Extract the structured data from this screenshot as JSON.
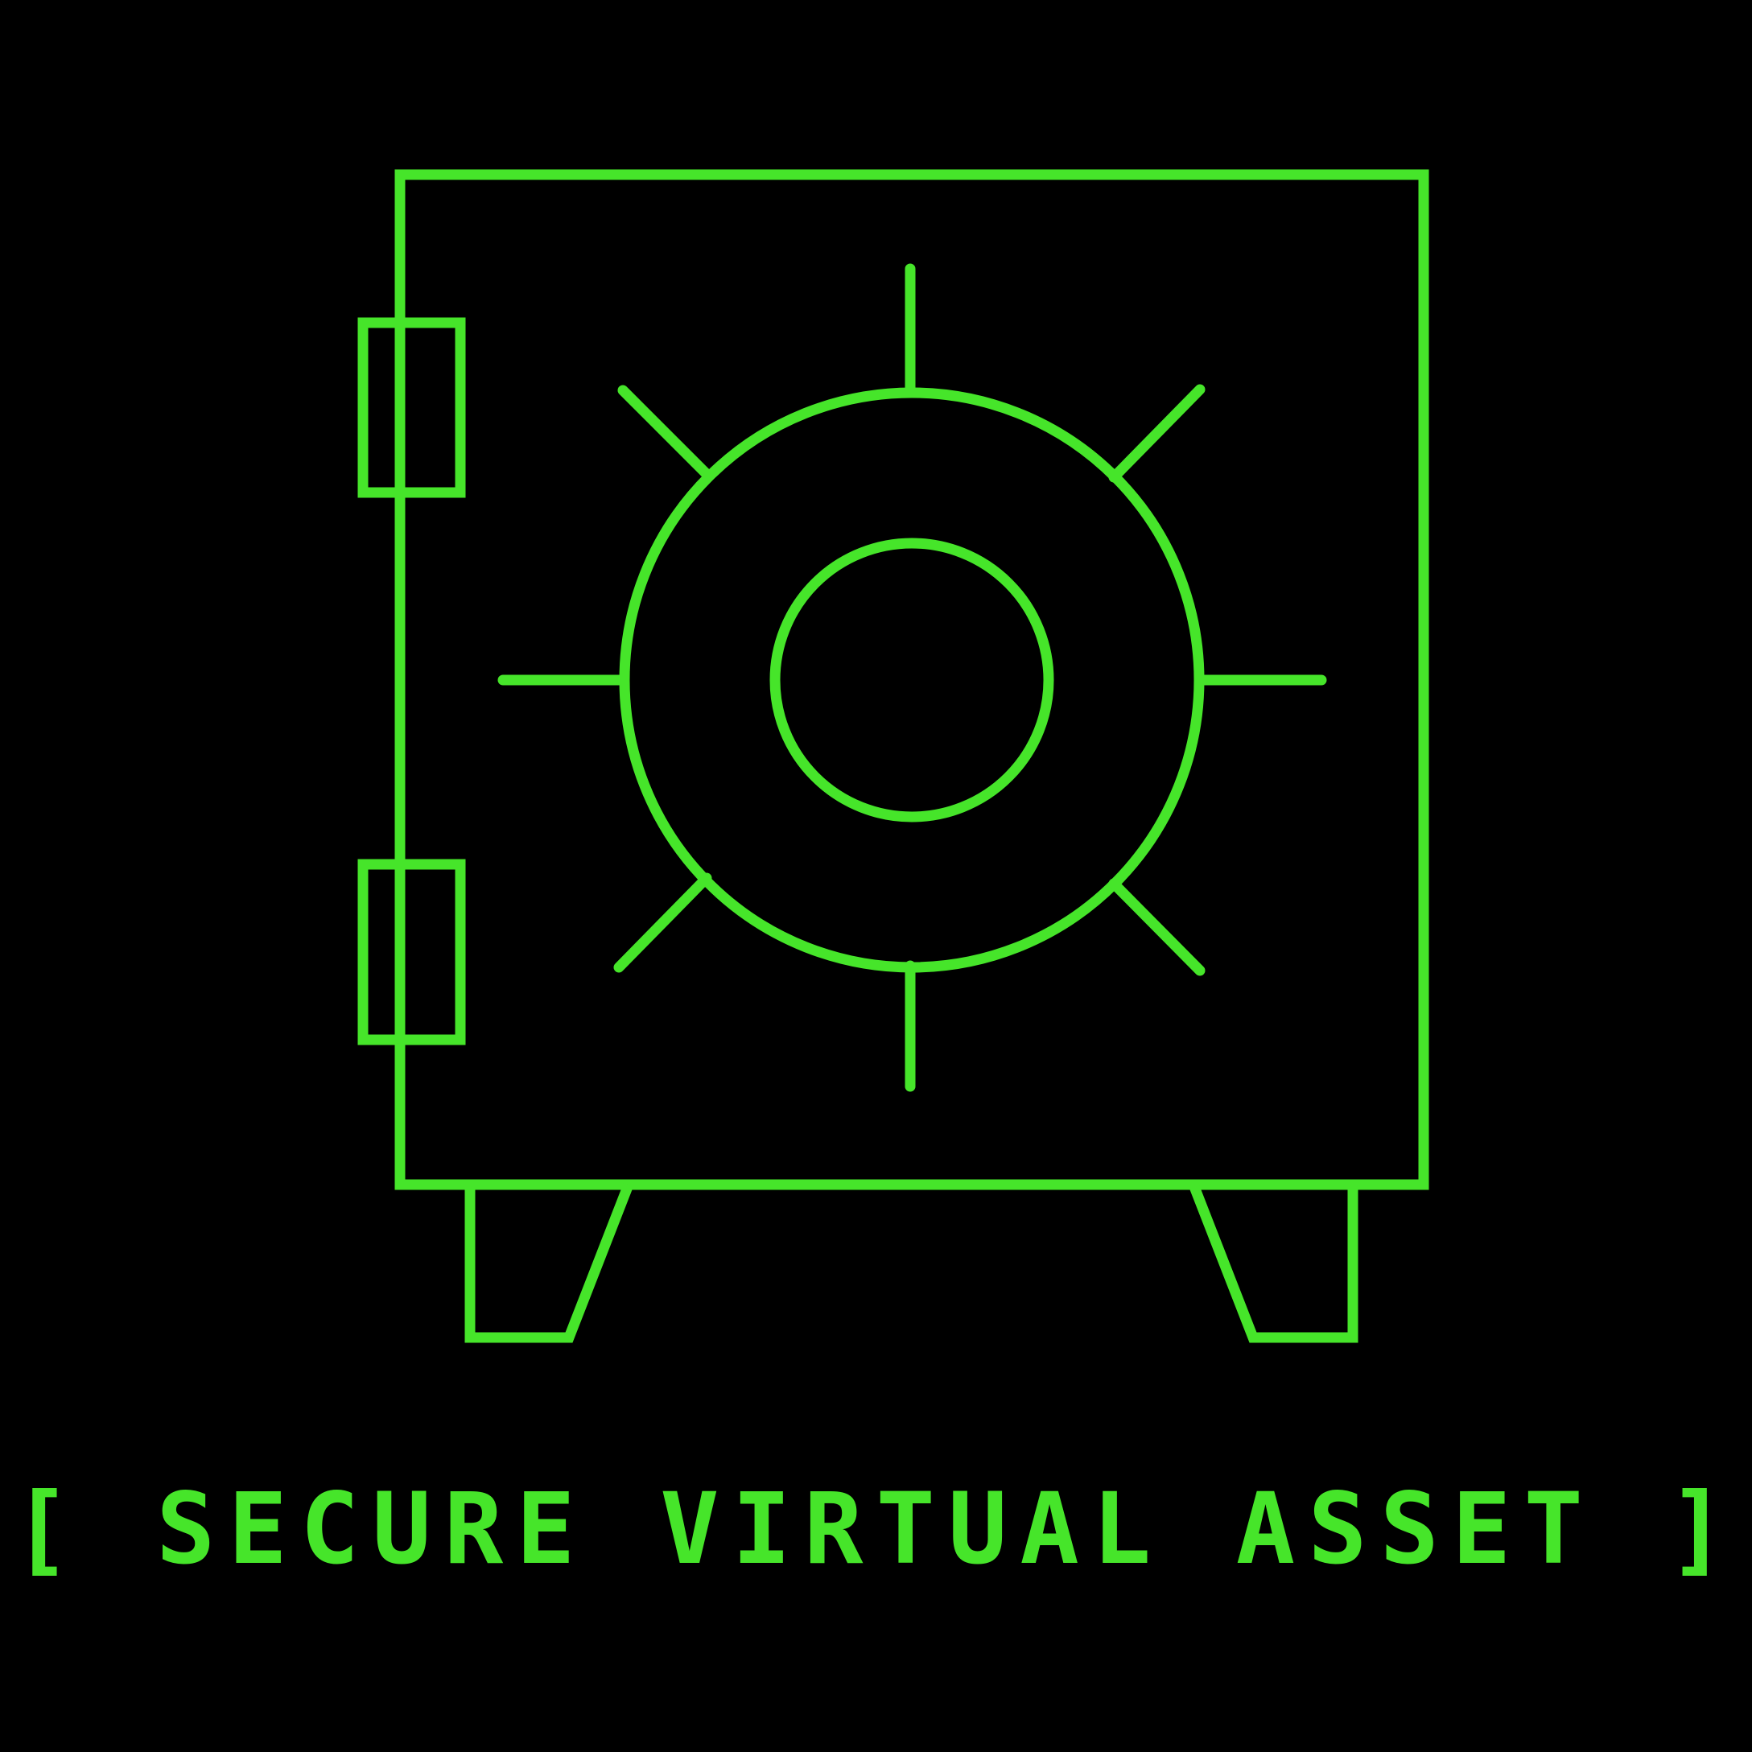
{
  "colors": {
    "background": "#000000",
    "accent": "#46e52a"
  },
  "illustration": {
    "icon": "vault-safe-icon",
    "parts": [
      "safe-body",
      "hinge-top",
      "hinge-bottom",
      "dial-outer",
      "dial-inner",
      "dial-spokes",
      "left-foot",
      "right-foot"
    ]
  },
  "caption": {
    "text": "[ SECURE VIRTUAL ASSET ]"
  }
}
